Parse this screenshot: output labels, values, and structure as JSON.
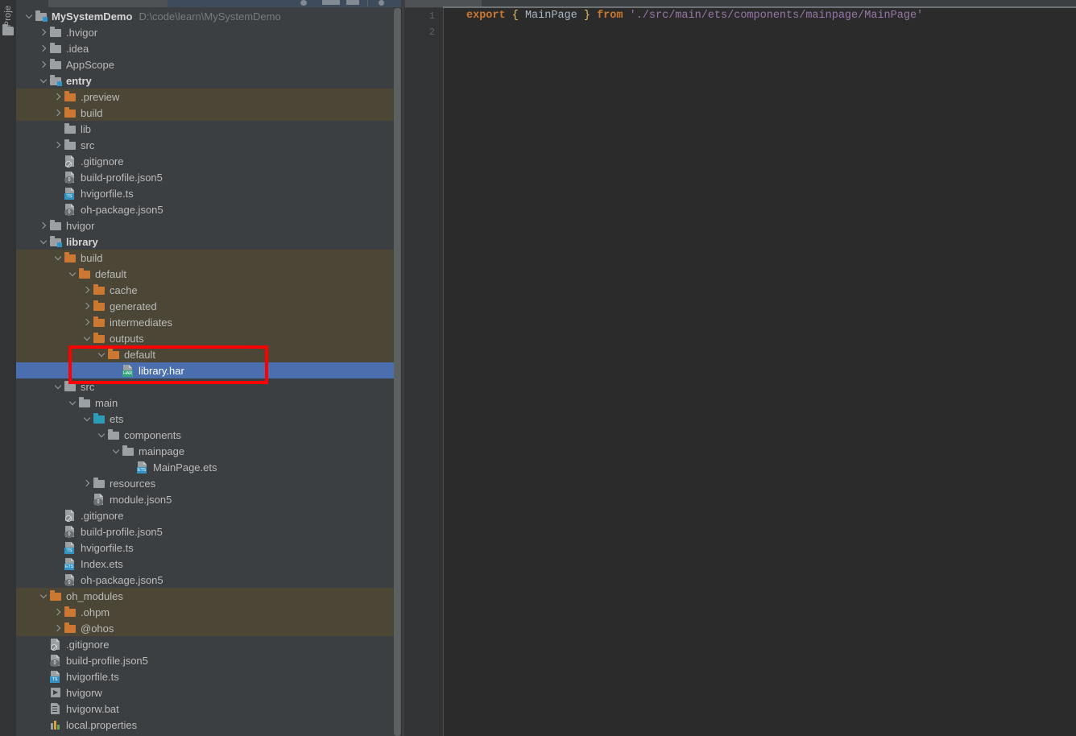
{
  "window": {
    "tool_stripe_label": "Proje",
    "tool_stripe_icon": "folder-icon"
  },
  "project_tree": {
    "root": {
      "label": "MySystemDemo",
      "path": "D:\\code\\learn\\MySystemDemo",
      "arrow": "expanded",
      "icon": "module-folder-icon"
    },
    "rows": [
      {
        "label": ".hvigor",
        "indent": 1,
        "arrow": "collapsed",
        "icon": "folder-gray-icon",
        "type": "folder"
      },
      {
        "label": ".idea",
        "indent": 1,
        "arrow": "collapsed",
        "icon": "folder-gray-icon",
        "type": "folder"
      },
      {
        "label": "AppScope",
        "indent": 1,
        "arrow": "collapsed",
        "icon": "folder-gray-icon",
        "type": "folder"
      },
      {
        "label": "entry",
        "indent": 1,
        "arrow": "expanded",
        "icon": "module-folder-icon",
        "type": "module",
        "bold": true
      },
      {
        "label": ".preview",
        "indent": 2,
        "arrow": "collapsed",
        "icon": "folder-orange-icon",
        "type": "folder",
        "highlight": "excluded"
      },
      {
        "label": "build",
        "indent": 2,
        "arrow": "collapsed",
        "icon": "folder-orange-icon",
        "type": "folder",
        "highlight": "excluded"
      },
      {
        "label": "lib",
        "indent": 2,
        "arrow": "none",
        "icon": "folder-gray-icon",
        "type": "folder"
      },
      {
        "label": "src",
        "indent": 2,
        "arrow": "collapsed",
        "icon": "folder-gray-icon",
        "type": "folder"
      },
      {
        "label": ".gitignore",
        "indent": 2,
        "arrow": "none",
        "icon": "gitignore-file-icon",
        "type": "git"
      },
      {
        "label": "build-profile.json5",
        "indent": 2,
        "arrow": "none",
        "icon": "json5-file-icon",
        "type": "json"
      },
      {
        "label": "hvigorfile.ts",
        "indent": 2,
        "arrow": "none",
        "icon": "typescript-file-icon",
        "type": "ts"
      },
      {
        "label": "oh-package.json5",
        "indent": 2,
        "arrow": "none",
        "icon": "json5-file-icon",
        "type": "json"
      },
      {
        "label": "hvigor",
        "indent": 1,
        "arrow": "collapsed",
        "icon": "folder-gray-icon",
        "type": "folder"
      },
      {
        "label": "library",
        "indent": 1,
        "arrow": "expanded",
        "icon": "module-folder-icon",
        "type": "module",
        "bold": true
      },
      {
        "label": "build",
        "indent": 2,
        "arrow": "expanded",
        "icon": "folder-orange-icon",
        "type": "folder",
        "highlight": "excluded"
      },
      {
        "label": "default",
        "indent": 3,
        "arrow": "expanded",
        "icon": "folder-orange-icon",
        "type": "folder",
        "highlight": "excluded"
      },
      {
        "label": "cache",
        "indent": 4,
        "arrow": "collapsed",
        "icon": "folder-orange-icon",
        "type": "folder",
        "highlight": "excluded"
      },
      {
        "label": "generated",
        "indent": 4,
        "arrow": "collapsed",
        "icon": "folder-orange-icon",
        "type": "folder",
        "highlight": "excluded"
      },
      {
        "label": "intermediates",
        "indent": 4,
        "arrow": "collapsed",
        "icon": "folder-orange-icon",
        "type": "folder",
        "highlight": "excluded"
      },
      {
        "label": "outputs",
        "indent": 4,
        "arrow": "expanded",
        "icon": "folder-orange-icon",
        "type": "folder",
        "highlight": "excluded"
      },
      {
        "label": "default",
        "indent": 5,
        "arrow": "expanded",
        "icon": "folder-orange-icon",
        "type": "folder",
        "highlight": "excluded"
      },
      {
        "label": "library.har",
        "indent": 6,
        "arrow": "none",
        "icon": "har-file-icon",
        "type": "har",
        "highlight": "selected"
      },
      {
        "label": "src",
        "indent": 2,
        "arrow": "expanded",
        "icon": "folder-gray-icon",
        "type": "folder"
      },
      {
        "label": "main",
        "indent": 3,
        "arrow": "expanded",
        "icon": "folder-gray-icon",
        "type": "folder"
      },
      {
        "label": "ets",
        "indent": 4,
        "arrow": "expanded",
        "icon": "folder-teal-icon",
        "type": "folder"
      },
      {
        "label": "components",
        "indent": 5,
        "arrow": "expanded",
        "icon": "folder-gray-icon",
        "type": "folder"
      },
      {
        "label": "mainpage",
        "indent": 6,
        "arrow": "expanded",
        "icon": "folder-gray-icon",
        "type": "folder"
      },
      {
        "label": "MainPage.ets",
        "indent": 7,
        "arrow": "none",
        "icon": "ets-file-icon",
        "type": "ets"
      },
      {
        "label": "resources",
        "indent": 4,
        "arrow": "collapsed",
        "icon": "folder-gray-icon",
        "type": "folder"
      },
      {
        "label": "module.json5",
        "indent": 4,
        "arrow": "none",
        "icon": "json5-file-icon",
        "type": "json"
      },
      {
        "label": ".gitignore",
        "indent": 2,
        "arrow": "none",
        "icon": "gitignore-file-icon",
        "type": "git"
      },
      {
        "label": "build-profile.json5",
        "indent": 2,
        "arrow": "none",
        "icon": "json5-file-icon",
        "type": "json"
      },
      {
        "label": "hvigorfile.ts",
        "indent": 2,
        "arrow": "none",
        "icon": "typescript-file-icon",
        "type": "ts"
      },
      {
        "label": "Index.ets",
        "indent": 2,
        "arrow": "none",
        "icon": "ets-file-icon",
        "type": "ets"
      },
      {
        "label": "oh-package.json5",
        "indent": 2,
        "arrow": "none",
        "icon": "json5-file-icon",
        "type": "json"
      },
      {
        "label": "oh_modules",
        "indent": 1,
        "arrow": "expanded",
        "icon": "folder-orange-icon",
        "type": "folder",
        "highlight": "excluded"
      },
      {
        "label": ".ohpm",
        "indent": 2,
        "arrow": "collapsed",
        "icon": "folder-orange-icon",
        "type": "folder",
        "highlight": "excluded"
      },
      {
        "label": "@ohos",
        "indent": 2,
        "arrow": "collapsed",
        "icon": "folder-orange-icon",
        "type": "folder",
        "highlight": "excluded"
      },
      {
        "label": ".gitignore",
        "indent": 1,
        "arrow": "none",
        "icon": "gitignore-file-icon",
        "type": "git"
      },
      {
        "label": "build-profile.json5",
        "indent": 1,
        "arrow": "none",
        "icon": "json5-file-icon",
        "type": "json"
      },
      {
        "label": "hvigorfile.ts",
        "indent": 1,
        "arrow": "none",
        "icon": "typescript-file-icon",
        "type": "ts"
      },
      {
        "label": "hvigorw",
        "indent": 1,
        "arrow": "none",
        "icon": "script-file-icon",
        "type": "sh"
      },
      {
        "label": "hvigorw.bat",
        "indent": 1,
        "arrow": "none",
        "icon": "batch-file-icon",
        "type": "bat"
      },
      {
        "label": "local.properties",
        "indent": 1,
        "arrow": "none",
        "icon": "properties-file-icon",
        "type": "props"
      }
    ]
  },
  "annotation": {
    "shape": "red-rectangle",
    "color": "#ff0000",
    "targets": [
      "default",
      "library.har"
    ]
  },
  "editor": {
    "tab_icon": "ets-file-icon",
    "gutter_lines": [
      "1",
      "2"
    ],
    "code": {
      "line1": {
        "kw_export": "export",
        "brace_open": "{",
        "identifier": "MainPage",
        "brace_close": "}",
        "kw_from": "from",
        "module_path": "'./src/main/ets/components/mainpage/MainPage'"
      },
      "line2": ""
    }
  },
  "colors": {
    "selection_blue": "#4b6eaf",
    "excluded_olive": "#4b4635",
    "panel_bg": "#3c3f41",
    "editor_bg": "#2b2b2b",
    "gutter_bg": "#313335",
    "folder_orange": "#cc7832",
    "folder_gray": "#9aa0a3",
    "folder_teal": "#2d9cb8",
    "annotation_red": "#ff0000",
    "string_purple": "#9876aa",
    "keyword_orange": "#cc7832"
  }
}
